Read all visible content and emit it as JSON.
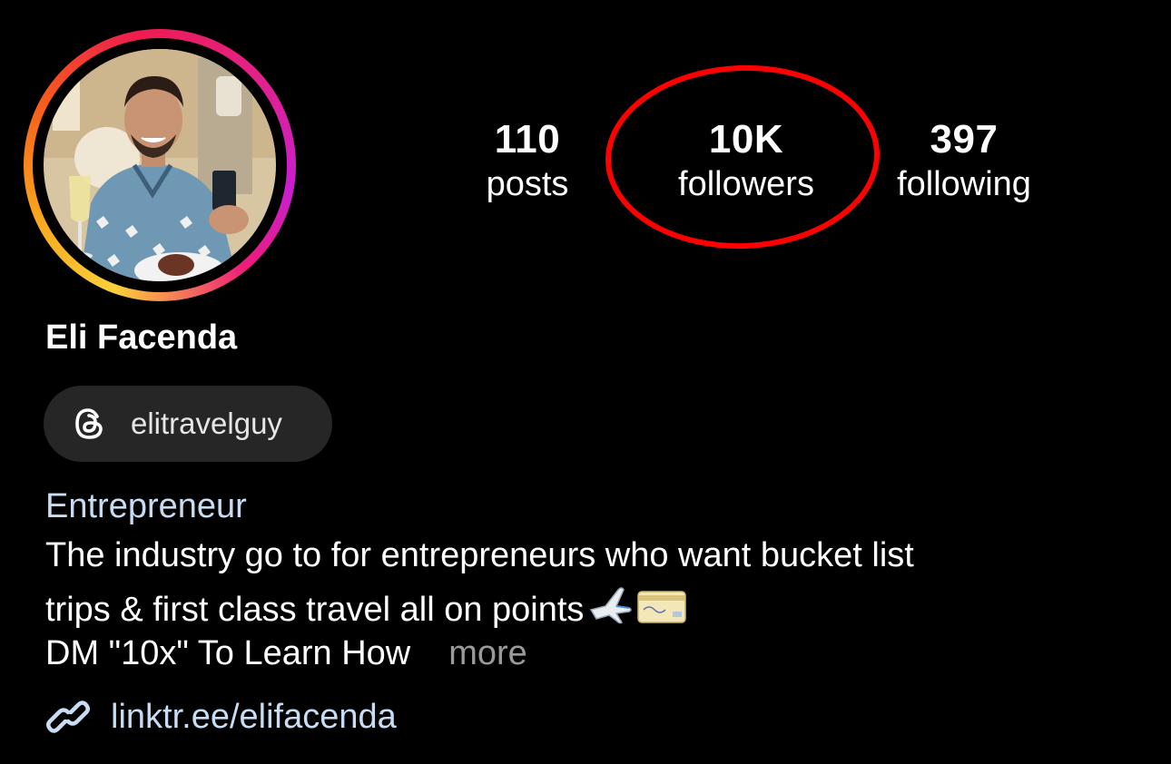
{
  "profile": {
    "name": "Eli Facenda",
    "avatar_icon": "profile-photo",
    "story_ring_colors": [
      "#fbd03a",
      "#f7591d",
      "#ee1c4f",
      "#c91ed1"
    ]
  },
  "stats": {
    "posts": {
      "count": "110",
      "label": "posts"
    },
    "followers": {
      "count": "10K",
      "label": "followers"
    },
    "following": {
      "count": "397",
      "label": "following"
    }
  },
  "annotation": {
    "highlight_color": "#ff0000",
    "highlight_shape": "ellipse"
  },
  "threads": {
    "icon": "threads-icon",
    "handle": "elitravelguy"
  },
  "bio": {
    "category": "Entrepreneur",
    "line1": "The industry go to for entrepreneurs who want bucket list",
    "line2": "trips & first class travel all on points",
    "line2_emojis": [
      "airplane-icon",
      "credit-card-icon"
    ],
    "line3": "DM \"10x\" To Learn How",
    "more_label": "more"
  },
  "link": {
    "icon": "link-icon",
    "text": "linktr.ee/elifacenda"
  },
  "colors": {
    "background": "#000000",
    "text": "#ffffff",
    "link": "#c8ddf3",
    "muted": "#9a9a9a",
    "pill": "#262626"
  }
}
